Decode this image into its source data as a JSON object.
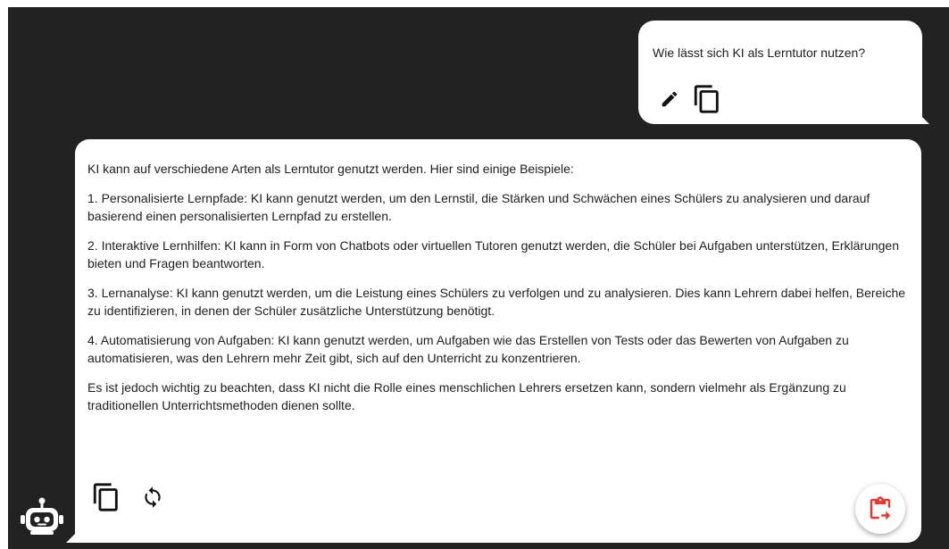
{
  "user_message": {
    "text": "Wie lässt sich KI als Lerntutor nutzen?",
    "actions": {
      "edit_icon": "pencil-icon",
      "copy_icon": "copy-icon"
    }
  },
  "bot_message": {
    "paragraphs": [
      "KI kann auf verschiedene Arten als Lerntutor genutzt werden. Hier sind einige Beispiele:",
      "1. Personalisierte Lernpfade: KI kann genutzt werden, um den Lernstil, die Stärken und Schwächen eines Schülers zu analysieren und darauf basierend einen personalisierten Lernpfad zu erstellen.",
      "2. Interaktive Lernhilfen: KI kann in Form von Chatbots oder virtuellen Tutoren genutzt werden, die Schüler bei Aufgaben unterstützen, Erklärungen bieten und Fragen beantworten.",
      "3. Lernanalyse: KI kann genutzt werden, um die Leistung eines Schülers zu verfolgen und zu analysieren. Dies kann Lehrern dabei helfen, Bereiche zu identifizieren, in denen der Schüler zusätzliche Unterstützung benötigt.",
      "4. Automatisierung von Aufgaben: KI kann genutzt werden, um Aufgaben wie das Erstellen von Tests oder das Bewerten von Aufgaben zu automatisieren, was den Lehrern mehr Zeit gibt, sich auf den Unterricht zu konzentrieren.",
      "Es ist jedoch wichtig zu beachten, dass KI nicht die Rolle eines menschlichen Lehrers ersetzen kann, sondern vielmehr als Ergänzung zu traditionellen Unterrichtsmethoden dienen sollte."
    ],
    "actions": {
      "copy_icon": "copy-icon",
      "regenerate_icon": "refresh-icon"
    },
    "fab_icon": "clipboard-export-icon"
  },
  "colors": {
    "background": "#222222",
    "bubble": "#ffffff",
    "text": "#1e1e1e",
    "accent": "#e53935"
  }
}
